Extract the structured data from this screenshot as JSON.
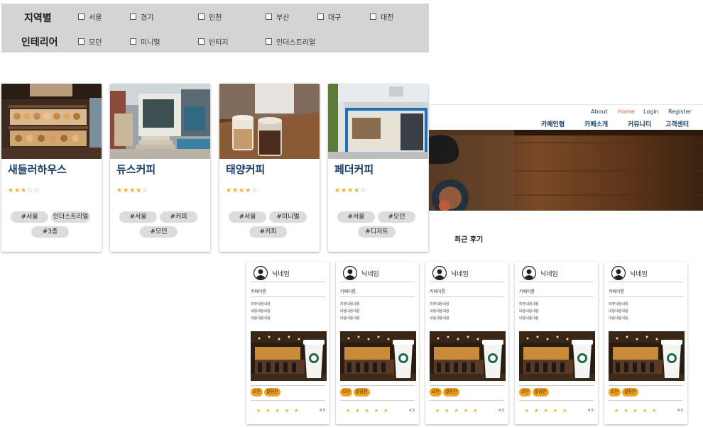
{
  "filters": {
    "region": {
      "label": "지역별",
      "options": [
        "서울",
        "경기",
        "인천",
        "부산",
        "대구",
        "대전"
      ]
    },
    "interior": {
      "label": "인테리어",
      "options": [
        "모던",
        "미니멀",
        "빈티지",
        "인더스트리얼"
      ]
    }
  },
  "cafes": [
    {
      "name": "새들러하우스",
      "rating": 3,
      "tags": [
        "#서울",
        "인더스트리얼",
        "#3층"
      ]
    },
    {
      "name": "듀스커피",
      "rating": 3.5,
      "tags": [
        "#서울",
        "#커피",
        "#모던"
      ]
    },
    {
      "name": "태양커피",
      "rating": 4,
      "tags": [
        "#서울",
        "#미니멀",
        "#커피"
      ]
    },
    {
      "name": "페더커피",
      "rating": 4,
      "tags": [
        "#서울",
        "#모던",
        "#디저트"
      ]
    }
  ],
  "nav": {
    "top_links": [
      "About",
      "Home",
      "Login",
      "Register"
    ],
    "active_link": "Home",
    "main_links": [
      "카페인형",
      "카페소개",
      "커뮤니티",
      "고객센터"
    ]
  },
  "colors": {
    "nav_text": "#1b3f66",
    "active_link": "#e2541b",
    "tag_bg": "#f4a21e",
    "star": "#e6b422"
  },
  "reviews_title": "최근 후기",
  "review_card": {
    "nickname": "닉네임",
    "cafe_name": "카페이름",
    "body_lines": [
      "리뷰내용내용",
      "내용내용내용",
      "내용내용내용"
    ],
    "tags": [
      "모던",
      "깔끔한"
    ],
    "stars": 5,
    "score": "4.5"
  },
  "review_count": 5
}
